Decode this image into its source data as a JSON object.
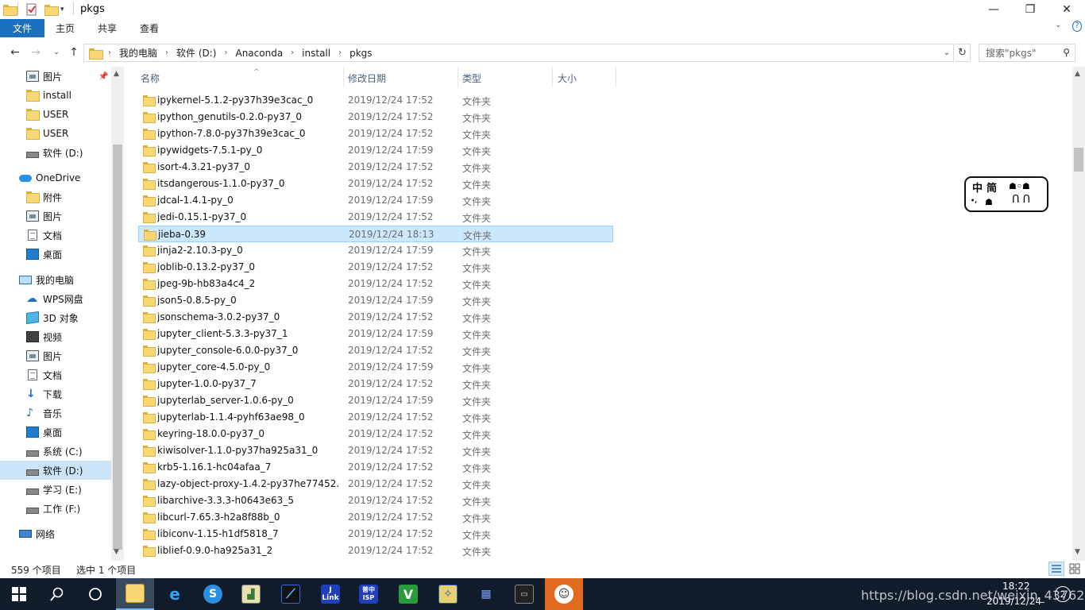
{
  "window": {
    "title": "pkgs"
  },
  "ribbon": {
    "tabs": [
      "文件",
      "主页",
      "共享",
      "查看"
    ],
    "help": "?"
  },
  "address": {
    "crumbs": [
      "我的电脑",
      "软件 (D:)",
      "Anaconda",
      "install",
      "pkgs"
    ],
    "search_placeholder": "搜索\"pkgs\""
  },
  "nav": {
    "items": [
      {
        "label": "图片",
        "icon": "pictures-icon",
        "pinned": true
      },
      {
        "label": "install",
        "icon": "folder-icon"
      },
      {
        "label": "USER",
        "icon": "folder-icon"
      },
      {
        "label": "USER",
        "icon": "folder-icon"
      },
      {
        "label": "软件 (D:)",
        "icon": "drive-icon"
      },
      {
        "label": "OneDrive",
        "icon": "onedrive-icon"
      },
      {
        "label": "附件",
        "icon": "folder-icon"
      },
      {
        "label": "图片",
        "icon": "pictures-icon"
      },
      {
        "label": "文档",
        "icon": "documents-icon"
      },
      {
        "label": "桌面",
        "icon": "desktop-icon"
      },
      {
        "label": "我的电脑",
        "icon": "computer-icon"
      },
      {
        "label": "WPS网盘",
        "icon": "cloud-icon"
      },
      {
        "label": "3D 对象",
        "icon": "3d-objects-icon"
      },
      {
        "label": "视频",
        "icon": "videos-icon"
      },
      {
        "label": "图片",
        "icon": "pictures-icon"
      },
      {
        "label": "文档",
        "icon": "documents-icon"
      },
      {
        "label": "下载",
        "icon": "downloads-icon"
      },
      {
        "label": "音乐",
        "icon": "music-icon"
      },
      {
        "label": "桌面",
        "icon": "desktop-icon"
      },
      {
        "label": "系统 (C:)",
        "icon": "drive-icon"
      },
      {
        "label": "软件 (D:)",
        "icon": "drive-icon",
        "selected": true
      },
      {
        "label": "学习 (E:)",
        "icon": "drive-icon"
      },
      {
        "label": "工作 (F:)",
        "icon": "drive-icon"
      },
      {
        "label": "网络",
        "icon": "network-icon"
      }
    ]
  },
  "columns": {
    "name": "名称",
    "date": "修改日期",
    "type": "类型",
    "size": "大小"
  },
  "files": [
    {
      "name": "ipykernel-5.1.2-py37h39e3cac_0",
      "date": "2019/12/24 17:52",
      "type": "文件夹"
    },
    {
      "name": "ipython_genutils-0.2.0-py37_0",
      "date": "2019/12/24 17:52",
      "type": "文件夹"
    },
    {
      "name": "ipython-7.8.0-py37h39e3cac_0",
      "date": "2019/12/24 17:52",
      "type": "文件夹"
    },
    {
      "name": "ipywidgets-7.5.1-py_0",
      "date": "2019/12/24 17:59",
      "type": "文件夹"
    },
    {
      "name": "isort-4.3.21-py37_0",
      "date": "2019/12/24 17:52",
      "type": "文件夹"
    },
    {
      "name": "itsdangerous-1.1.0-py37_0",
      "date": "2019/12/24 17:52",
      "type": "文件夹"
    },
    {
      "name": "jdcal-1.4.1-py_0",
      "date": "2019/12/24 17:59",
      "type": "文件夹"
    },
    {
      "name": "jedi-0.15.1-py37_0",
      "date": "2019/12/24 17:52",
      "type": "文件夹"
    },
    {
      "name": "jieba-0.39",
      "date": "2019/12/24 18:13",
      "type": "文件夹",
      "selected": true
    },
    {
      "name": "jinja2-2.10.3-py_0",
      "date": "2019/12/24 17:59",
      "type": "文件夹"
    },
    {
      "name": "joblib-0.13.2-py37_0",
      "date": "2019/12/24 17:52",
      "type": "文件夹"
    },
    {
      "name": "jpeg-9b-hb83a4c4_2",
      "date": "2019/12/24 17:52",
      "type": "文件夹"
    },
    {
      "name": "json5-0.8.5-py_0",
      "date": "2019/12/24 17:59",
      "type": "文件夹"
    },
    {
      "name": "jsonschema-3.0.2-py37_0",
      "date": "2019/12/24 17:52",
      "type": "文件夹"
    },
    {
      "name": "jupyter_client-5.3.3-py37_1",
      "date": "2019/12/24 17:59",
      "type": "文件夹"
    },
    {
      "name": "jupyter_console-6.0.0-py37_0",
      "date": "2019/12/24 17:52",
      "type": "文件夹"
    },
    {
      "name": "jupyter_core-4.5.0-py_0",
      "date": "2019/12/24 17:59",
      "type": "文件夹"
    },
    {
      "name": "jupyter-1.0.0-py37_7",
      "date": "2019/12/24 17:52",
      "type": "文件夹"
    },
    {
      "name": "jupyterlab_server-1.0.6-py_0",
      "date": "2019/12/24 17:59",
      "type": "文件夹"
    },
    {
      "name": "jupyterlab-1.1.4-pyhf63ae98_0",
      "date": "2019/12/24 17:52",
      "type": "文件夹"
    },
    {
      "name": "keyring-18.0.0-py37_0",
      "date": "2019/12/24 17:52",
      "type": "文件夹"
    },
    {
      "name": "kiwisolver-1.1.0-py37ha925a31_0",
      "date": "2019/12/24 17:52",
      "type": "文件夹"
    },
    {
      "name": "krb5-1.16.1-hc04afaa_7",
      "date": "2019/12/24 17:52",
      "type": "文件夹"
    },
    {
      "name": "lazy-object-proxy-1.4.2-py37he77452...",
      "date": "2019/12/24 17:52",
      "type": "文件夹"
    },
    {
      "name": "libarchive-3.3.3-h0643e63_5",
      "date": "2019/12/24 17:52",
      "type": "文件夹"
    },
    {
      "name": "libcurl-7.65.3-h2a8f88b_0",
      "date": "2019/12/24 17:52",
      "type": "文件夹"
    },
    {
      "name": "libiconv-1.15-h1df5818_7",
      "date": "2019/12/24 17:52",
      "type": "文件夹"
    },
    {
      "name": "liblief-0.9.0-ha925a31_2",
      "date": "2019/12/24 17:52",
      "type": "文件夹"
    }
  ],
  "ime": {
    "chars": [
      "中",
      "简"
    ]
  },
  "status": {
    "count": "559 个项目",
    "selected": "选中 1 个项目"
  },
  "taskbar": {
    "time": "18:22",
    "date": "2019/12/24",
    "apps": [
      "file-explorer",
      "edge",
      "browser",
      "editor",
      "compass",
      "jlink",
      "isp",
      "v-app",
      "shield-app",
      "grid-app",
      "terminal",
      "avatar-app"
    ],
    "watermark": "https://blog.csdn.net/weixin_43762",
    "notification_count": "2"
  }
}
